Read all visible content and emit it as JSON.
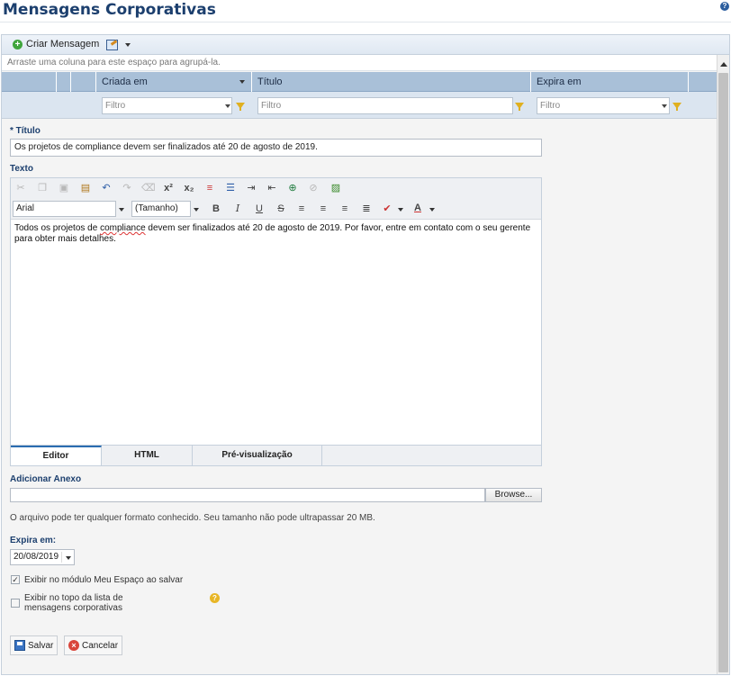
{
  "page": {
    "title": "Mensagens Corporativas",
    "help_icon": "help-icon"
  },
  "toolbar": {
    "create_label": "Criar Mensagem",
    "create_icon": "plus-circle-icon",
    "edit_icon": "edit-icon"
  },
  "grid": {
    "group_hint": "Arraste uma coluna para este espaço para agrupá-la.",
    "columns": [
      "Criada em",
      "Título",
      "Expira em"
    ],
    "filter_placeholder": "Filtro"
  },
  "form": {
    "title_label": "* Título",
    "title_value": "Os projetos de compliance devem ser finalizados até 20 de agosto de 2019.",
    "text_label": "Texto",
    "font_value": "Arial",
    "size_value": "(Tamanho)",
    "body_before": "Todos os projetos de ",
    "body_misspelled": "compliance",
    "body_after": " devem ser finalizados até 20 de agosto de 2019. Por favor, entre em contato com o seu gerente para obter mais detalhes.",
    "tabs": [
      "Editor",
      "HTML",
      "Pré-visualização"
    ],
    "active_tab": "Editor",
    "attach_label": "Adicionar Anexo",
    "browse_label": "Browse...",
    "attach_note": "O arquivo pode ter qualquer formato conhecido. Seu tamanho não pode ultrapassar 20 MB.",
    "expires_label": "Expira em:",
    "expires_value": "20/08/2019",
    "check1_label": "Exibir no módulo Meu Espaço ao salvar",
    "check1_checked": true,
    "check2_label": "Exibir no topo da lista de mensagens corporativas",
    "check2_checked": false,
    "save_label": "Salvar",
    "cancel_label": "Cancelar"
  }
}
